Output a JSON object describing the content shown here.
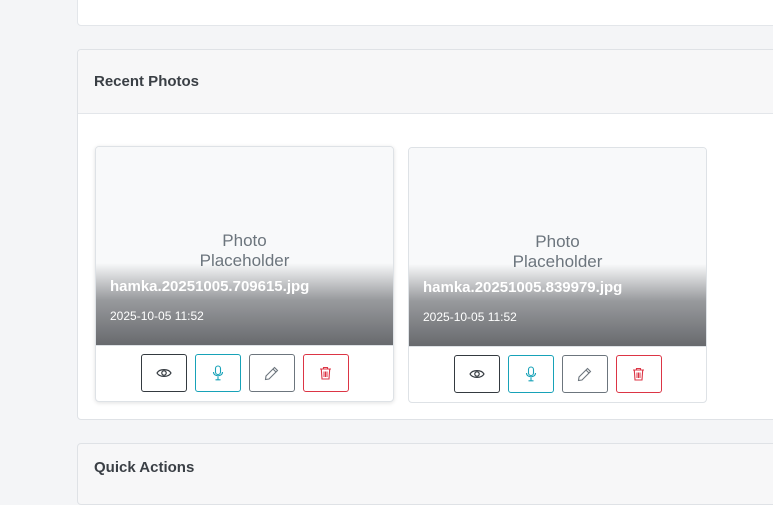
{
  "recent_photos": {
    "title": "Recent Photos",
    "photos": [
      {
        "placeholder": "Photo\nPlaceholder",
        "filename": "hamka.20251005.709615.jpg",
        "date": "2025-10-05 11:52"
      },
      {
        "placeholder": "Photo\nPlaceholder",
        "filename": "hamka.20251005.839979.jpg",
        "date": "2025-10-05 11:52"
      }
    ],
    "actions": [
      {
        "icon": "eye-icon",
        "color": "#343a40"
      },
      {
        "icon": "microphone-icon",
        "color": "#17a2b8"
      },
      {
        "icon": "pencil-icon",
        "color": "#6c757d"
      },
      {
        "icon": "trash-icon",
        "color": "#dc3545"
      }
    ]
  },
  "quick_actions": {
    "title": "Quick Actions"
  }
}
